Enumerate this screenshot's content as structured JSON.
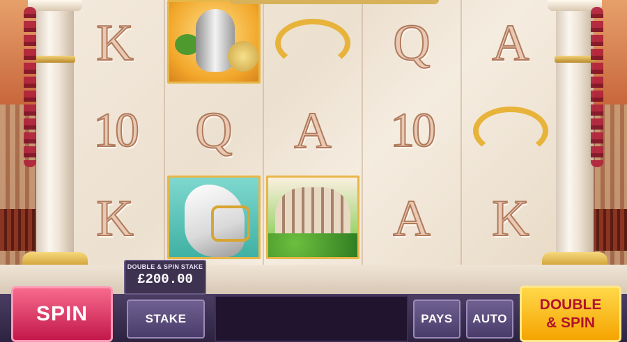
{
  "reels": {
    "row1": [
      "K",
      "vase-symbol",
      "laurel-symbol",
      "Q",
      "A"
    ],
    "row2": [
      "10",
      "Q",
      "A",
      "10",
      "laurel-symbol"
    ],
    "row3": [
      "K",
      "horse-symbol",
      "colosseum-symbol",
      "A",
      "K"
    ]
  },
  "controls": {
    "spin_label": "SPIN",
    "stake_label": "STAKE",
    "pays_label": "PAYS",
    "auto_label": "AUTO",
    "double_spin_label_line1": "DOUBLE",
    "double_spin_label_line2": "& SPIN"
  },
  "double_stake": {
    "label": "DOUBLE & SPIN STAKE",
    "value": "£200.00"
  },
  "colors": {
    "spin": "#d6245a",
    "double_spin": "#f8c11a",
    "panel": "#3a2d52",
    "letter": "#e9c9b3"
  }
}
